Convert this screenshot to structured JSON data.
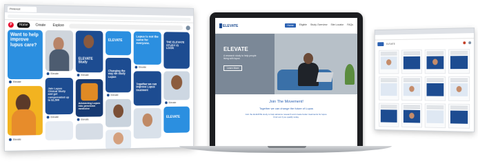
{
  "colors": {
    "brand_blue": "#1d4c91",
    "bright_blue": "#2b61b2",
    "pinterest_red": "#e60023",
    "sky_blue": "#3aa0e0"
  },
  "left_browser": {
    "tab_title": "Pinterest",
    "nav": {
      "home": "Home",
      "create": "Create",
      "explore": "Explore"
    },
    "pins": [
      {
        "title": "Want to help improve lupus care?"
      },
      {
        "title": "ELEVATE Study"
      },
      {
        "title": "ELEVATE"
      },
      {
        "title": "Lupus is not the same for everyone."
      },
      {
        "title": "THE ELEVATE STUDY IS LOOK"
      },
      {
        "title": "Changing the way we study Lupus"
      },
      {
        "title": "Join Lupus Clinical Study and get compensated up to $1,500"
      },
      {
        "title": "Advancing Lupus into precision medicine"
      },
      {
        "title": "Together we can improve Lupus treatment"
      },
      {
        "title": "ELEVATE"
      }
    ],
    "pin_author": "Elevate"
  },
  "laptop_site": {
    "logo": "ELEVATE",
    "nav": [
      "Home",
      "Eligible",
      "Study Overview",
      "Site Locator",
      "FAQs"
    ],
    "hero_title": "ELEVATE",
    "hero_sub": "A research study to help people living with lupus",
    "hero_button": "Learn More",
    "heading": "Join The Movement!",
    "subheading": "Together we can change the future of Lupus",
    "body": "Join the ELEVATE study to help advance research and create better treatments for lupus. Find out if you qualify today."
  },
  "right_browser": {
    "brand": "ELEVATE",
    "cards": 12
  }
}
